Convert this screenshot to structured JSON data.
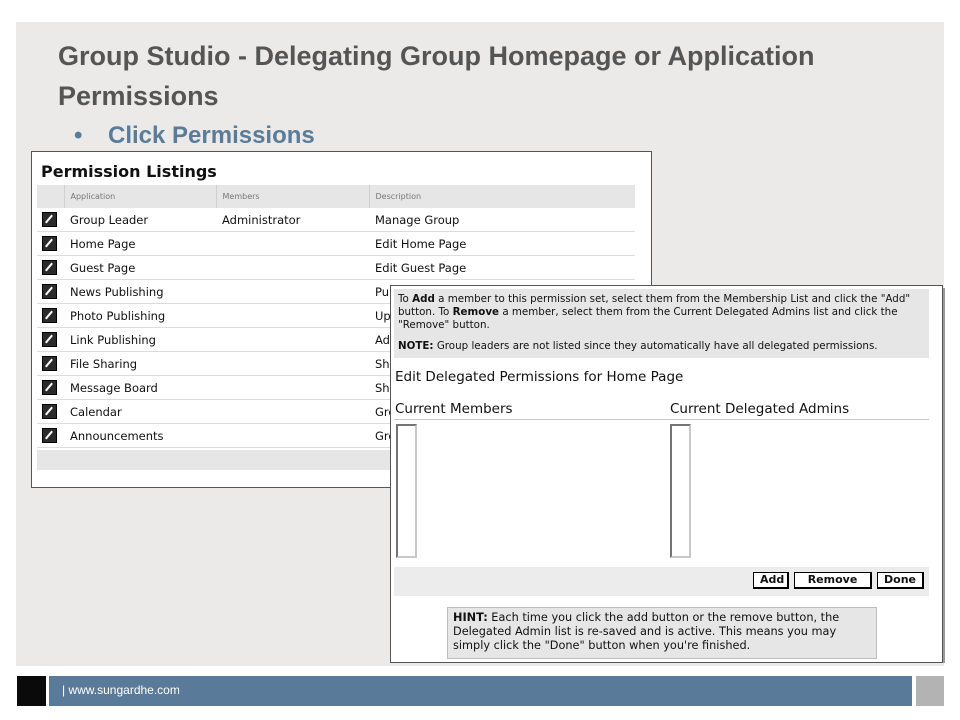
{
  "slide": {
    "title": "Group Studio - Delegating Group Homepage or Application Permissions",
    "bullet": "Click Permissions",
    "footer_text": "| www.sungardhe.com"
  },
  "permission_listings": {
    "title": "Permission Listings",
    "columns": [
      "Application",
      "Members",
      "Description"
    ],
    "rows": [
      {
        "application": "Group Leader",
        "members": "Administrator",
        "description": "Manage Group"
      },
      {
        "application": "Home Page",
        "members": "",
        "description": "Edit Home Page"
      },
      {
        "application": "Guest Page",
        "members": "",
        "description": "Edit Guest Page"
      },
      {
        "application": "News Publishing",
        "members": "",
        "description": "Pu"
      },
      {
        "application": "Photo Publishing",
        "members": "",
        "description": "Up"
      },
      {
        "application": "Link Publishing",
        "members": "",
        "description": "Ad"
      },
      {
        "application": "File Sharing",
        "members": "",
        "description": "Sh"
      },
      {
        "application": "Message Board",
        "members": "",
        "description": "Sh"
      },
      {
        "application": "Calendar",
        "members": "",
        "description": "Gro"
      },
      {
        "application": "Announcements",
        "members": "",
        "description": "Gro"
      }
    ],
    "row_icon": "edit-icon"
  },
  "edit_permissions": {
    "info_add_prefix": "To ",
    "info_add_bold": "Add",
    "info_add_mid": " a member to this permission set, select them from the Membership List and click the \"Add\" button. To ",
    "info_remove_bold": "Remove",
    "info_remove_rest": " a member, select them from the Current Delegated Admins list and click the \"Remove\" button.",
    "note_label": "NOTE:",
    "note_text": " Group leaders are not listed since they automatically have all delegated permissions.",
    "heading": "Edit Delegated Permissions for Home Page",
    "current_members_label": "Current Members",
    "current_admins_label": "Current Delegated Admins",
    "buttons": {
      "add": "Add",
      "remove": "Remove",
      "done": "Done"
    },
    "hint_label": "HINT:",
    "hint_text": " Each time you click the add button or the remove button, the Delegated Admin list is re-saved and is active. This means you may simply click the \"Done\" button when you're finished."
  }
}
